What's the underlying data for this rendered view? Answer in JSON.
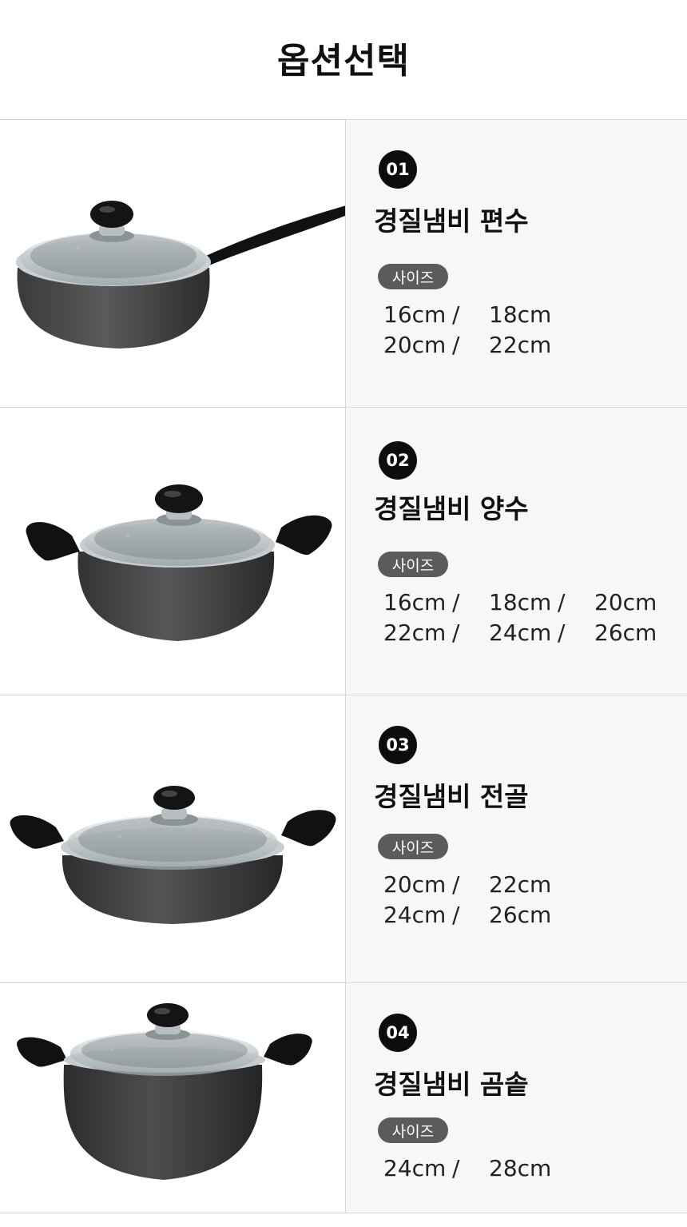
{
  "header": {
    "title": "옵션선택"
  },
  "options": [
    {
      "number": "01",
      "name": "경질냄비 편수",
      "size_label": "사이즈",
      "rows": [
        [
          "16cm",
          "18cm"
        ],
        [
          "20cm",
          "22cm"
        ]
      ]
    },
    {
      "number": "02",
      "name": "경질냄비 양수",
      "size_label": "사이즈",
      "rows": [
        [
          "16cm",
          "18cm",
          "20cm"
        ],
        [
          "22cm",
          "24cm",
          "26cm"
        ]
      ]
    },
    {
      "number": "03",
      "name": "경질냄비 전골",
      "size_label": "사이즈",
      "rows": [
        [
          "20cm",
          "22cm"
        ],
        [
          "24cm",
          "26cm"
        ]
      ]
    },
    {
      "number": "04",
      "name": "경질냄비 곰솥",
      "size_label": "사이즈",
      "rows": [
        [
          "24cm",
          "28cm"
        ]
      ]
    }
  ],
  "separator": "/",
  "colors": {
    "badge": "#0d0d0d",
    "chip": "#5b5b5b",
    "panel": "#f7f7f7"
  }
}
